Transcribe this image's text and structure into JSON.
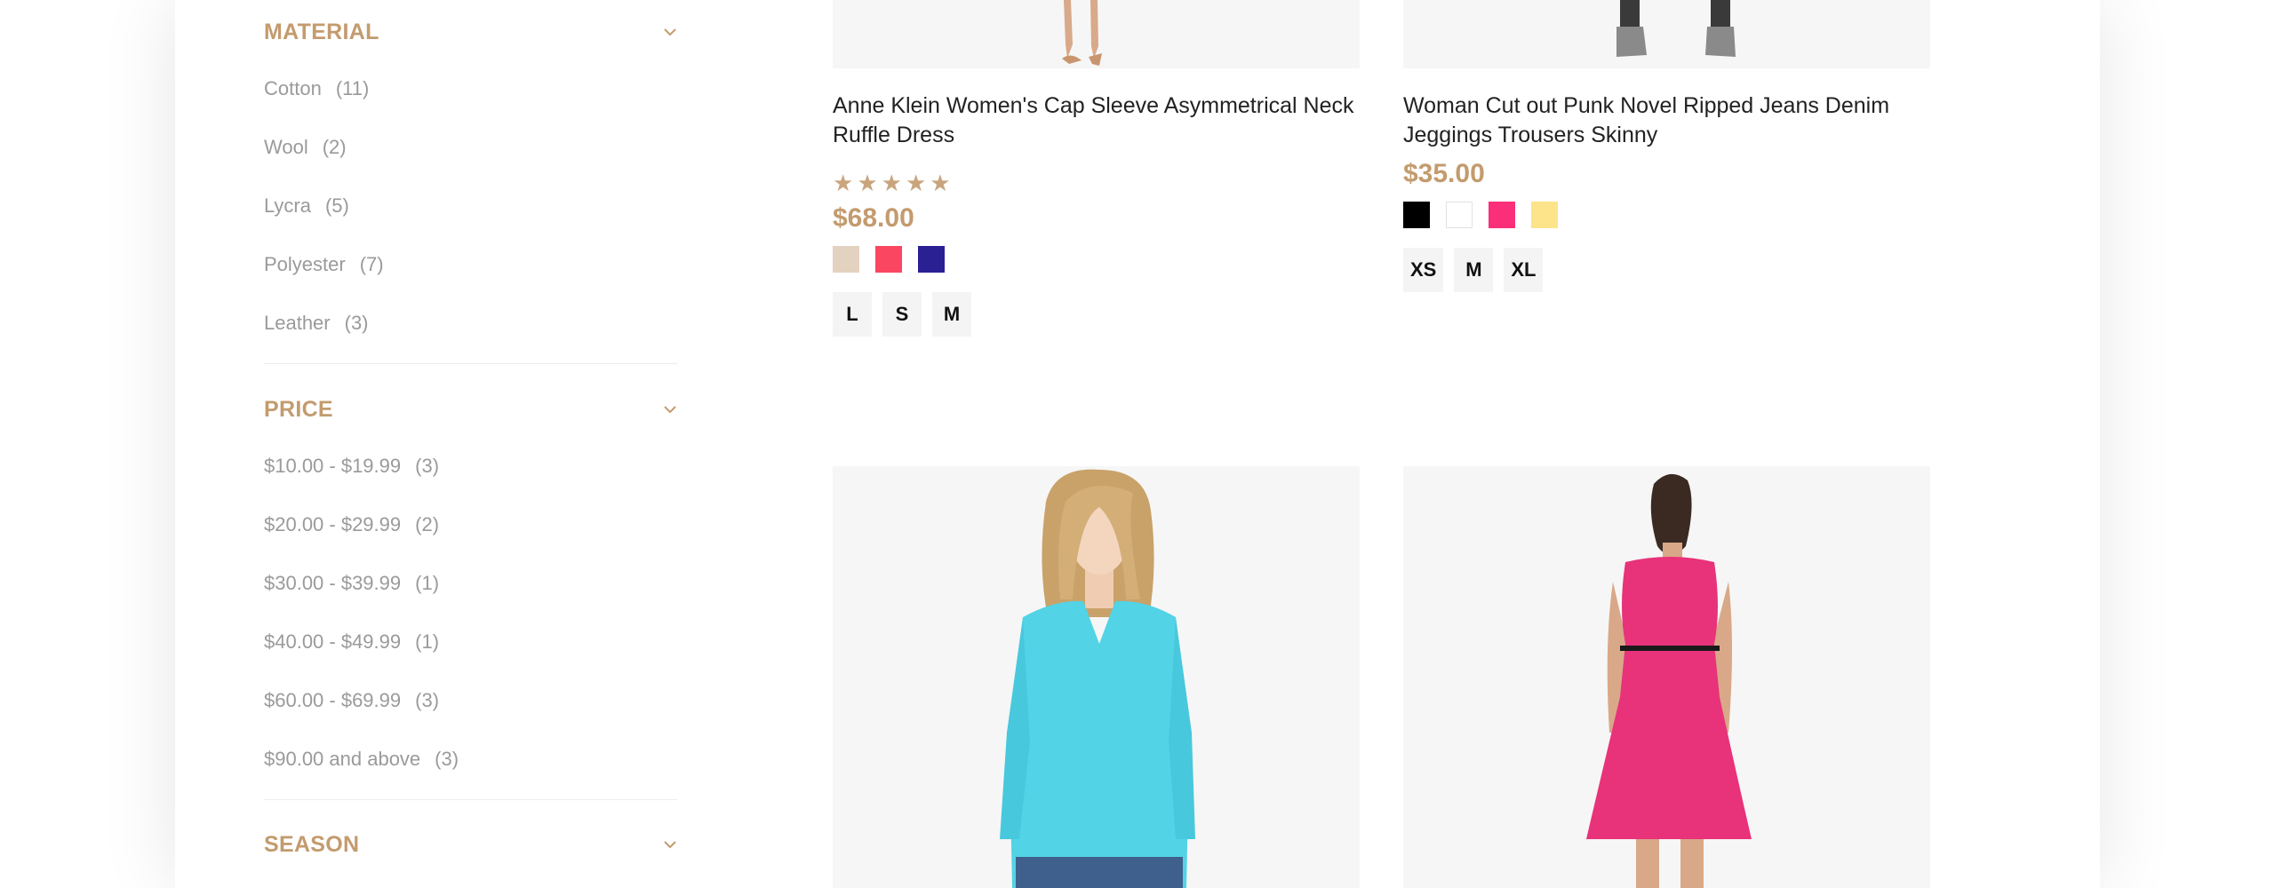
{
  "sidebar": {
    "material": {
      "title": "MATERIAL",
      "items": [
        {
          "label": "Cotton",
          "count": "(11)"
        },
        {
          "label": "Wool",
          "count": "(2)"
        },
        {
          "label": "Lycra",
          "count": "(5)"
        },
        {
          "label": "Polyester",
          "count": "(7)"
        },
        {
          "label": "Leather",
          "count": "(3)"
        }
      ]
    },
    "price": {
      "title": "PRICE",
      "items": [
        {
          "label": "$10.00 - $19.99",
          "count": "(3)"
        },
        {
          "label": "$20.00 - $29.99",
          "count": "(2)"
        },
        {
          "label": "$30.00 - $39.99",
          "count": "(1)"
        },
        {
          "label": "$40.00 - $49.99",
          "count": "(1)"
        },
        {
          "label": "$60.00 - $69.99",
          "count": "(3)"
        },
        {
          "label": "$90.00 and above",
          "count": "(3)"
        }
      ]
    },
    "season": {
      "title": "SEASON"
    }
  },
  "products": [
    {
      "title": "Anne Klein Women's Cap Sleeve Asymmetrical Neck Ruffle Dress",
      "rating": 5,
      "price": "$68.00",
      "swatches": [
        "#e3d2c0",
        "#fa4660",
        "#2b1f94"
      ],
      "sizes": [
        "L",
        "S",
        "M"
      ]
    },
    {
      "title": "Woman Cut out Punk Novel Ripped Jeans Denim Jeggings Trousers Skinny",
      "price": "$35.00",
      "swatches": [
        "#000000",
        "#ffffff",
        "#fb2e79",
        "#fde48a"
      ],
      "sizes": [
        "XS",
        "M",
        "XL"
      ]
    }
  ],
  "colors": {
    "accent": "#c39b6e",
    "star": "#c9a57e",
    "image_bg": "#f6f6f6"
  },
  "icons": {
    "chevron": "chevron-down-icon",
    "star": "star-icon"
  }
}
